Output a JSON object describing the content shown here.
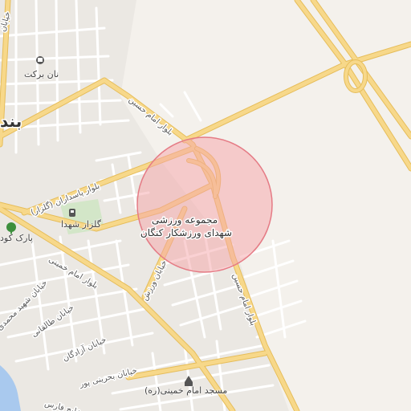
{
  "map": {
    "highlight_label": [
      "مجموعه ورزشی",
      "شهدای ورزشکار کنگان"
    ],
    "city_label": "بند",
    "places": [
      {
        "id": "bakery",
        "name": "نان برکت",
        "icon": "bakery-icon"
      },
      {
        "id": "cemetery",
        "name": "گلزار شهدا",
        "icon": "cemetery-icon"
      },
      {
        "id": "park",
        "name": "پارک کود",
        "icon": "park-icon"
      },
      {
        "id": "mosque",
        "name": "مسجد امام خمینی(ره)",
        "icon": "mosque-icon"
      }
    ],
    "streets": {
      "imam_hossein_n": "بلوار امام حسین",
      "imam_hossein_s": "بلوار امام حسین",
      "pasdaran": "بلوار پاسداران (گلزار)",
      "varzesh": "خیابان ورزش",
      "imam_khomeini": "بلوار امام خمینی",
      "shahid_mohammadi": "خیابان شهید محمدی",
      "taleghani": "خیابان طالقانی",
      "azadegan": "خیابان آزادگان",
      "bahrini_pour": "خیابان بحرینی پور",
      "khalij_fars": "خلیج فارس",
      "top_left": "خیابان"
    },
    "colors": {
      "background": "#f4f1ec",
      "urban": "#ebe8e3",
      "major_road": "#f7d88a",
      "major_road_casing": "#e6bd5a",
      "minor_road": "#ffffff",
      "minor_road_casing": "#d8d4cc",
      "water": "#a9c9ee",
      "park": "#d3e6c8",
      "highlight_fill": "#f5a3a8",
      "highlight_stroke": "#e57b85"
    }
  }
}
